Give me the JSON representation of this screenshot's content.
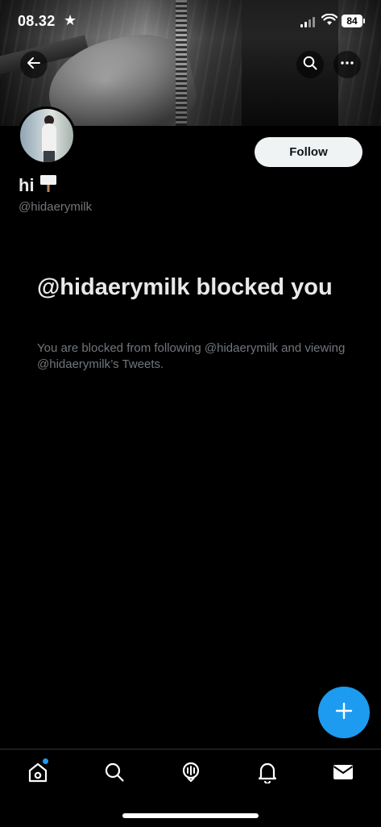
{
  "status_bar": {
    "time": "08.32",
    "battery": "84"
  },
  "header": {
    "back_icon": "arrow-left-icon",
    "search_icon": "search-icon",
    "more_icon": "more-horizontal-icon"
  },
  "profile": {
    "display_name": "hi",
    "display_emoji": "placard-icon",
    "handle": "@hidaerymilk",
    "follow_label": "Follow"
  },
  "blocked": {
    "title": "@hidaerymilk blocked you",
    "description": "You are blocked from following @hidaerymilk and viewing @hidaerymilk’s Tweets."
  },
  "fab": {
    "icon": "plus-icon"
  },
  "tabs": [
    {
      "icon": "home-icon",
      "has_dot": true
    },
    {
      "icon": "search-icon"
    },
    {
      "icon": "spaces-icon"
    },
    {
      "icon": "bell-icon"
    },
    {
      "icon": "mail-icon"
    }
  ],
  "colors": {
    "accent": "#1d9bf0",
    "background": "#000000",
    "text_primary": "#e7e9ea",
    "text_secondary": "#71767b"
  }
}
